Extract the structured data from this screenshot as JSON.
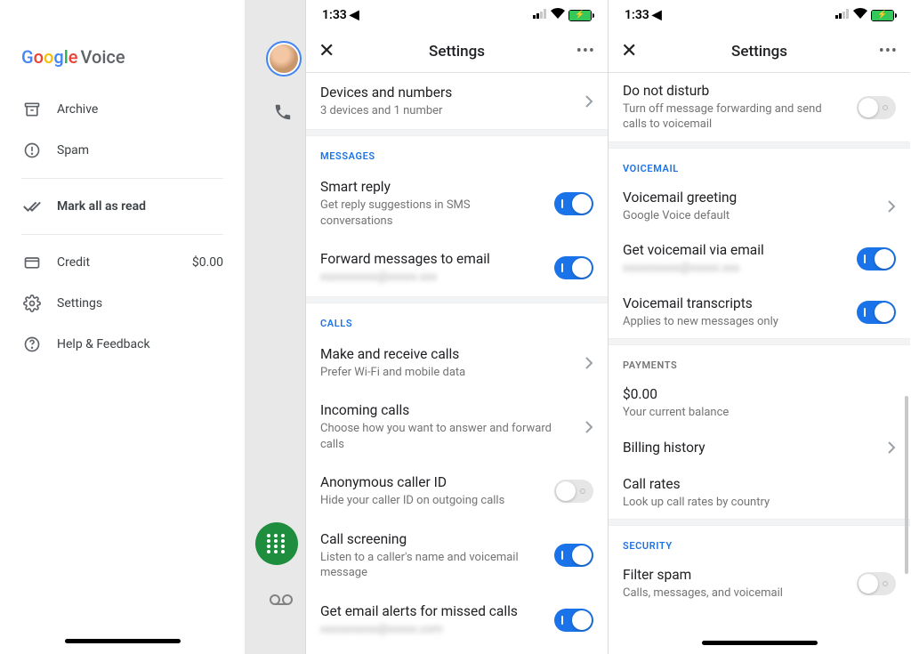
{
  "panel1": {
    "logo_voice": "Voice",
    "menu": {
      "archive": "Archive",
      "spam": "Spam",
      "mark_all": "Mark all as read",
      "credit": "Credit",
      "credit_value": "$0.00",
      "settings": "Settings",
      "help": "Help & Feedback"
    }
  },
  "status": {
    "time": "1:33"
  },
  "nav": {
    "title": "Settings"
  },
  "p2": {
    "devices_title": "Devices and numbers",
    "devices_sub": "3 devices and 1 number",
    "hdr_messages": "MESSAGES",
    "smart_title": "Smart reply",
    "smart_sub": "Get reply suggestions in SMS conversations",
    "fwd_title": "Forward messages to email",
    "fwd_sub": "xxxxxxxxxx@xxxxx.xxx",
    "hdr_calls": "CALLS",
    "make_title": "Make and receive calls",
    "make_sub": "Prefer Wi-Fi and mobile data",
    "incoming_title": "Incoming calls",
    "incoming_sub": "Choose how you want to answer and forward calls",
    "anon_title": "Anonymous caller ID",
    "anon_sub": "Hide your caller ID on outgoing calls",
    "screen_title": "Call screening",
    "screen_sub": "Listen to a caller's name and voicemail message",
    "missed_title": "Get email alerts for missed calls",
    "missed_sub": "xxxxxxxxxx@xxxxx.com"
  },
  "p3": {
    "dnd_title": "Do not disturb",
    "dnd_sub": "Turn off message forwarding and send calls to voicemail",
    "hdr_voicemail": "VOICEMAIL",
    "greet_title": "Voicemail greeting",
    "greet_sub": "Google Voice default",
    "vmemail_title": "Get voicemail via email",
    "vmemail_sub": "xxxxxxxxxx@xxxxx.xxx",
    "trans_title": "Voicemail transcripts",
    "trans_sub": "Applies to new messages only",
    "hdr_payments": "PAYMENTS",
    "balance_title": "$0.00",
    "balance_sub": "Your current balance",
    "billing_title": "Billing history",
    "rates_title": "Call rates",
    "rates_sub": "Look up call rates by country",
    "hdr_security": "SECURITY",
    "spam_title": "Filter spam",
    "spam_sub": "Calls, messages, and voicemail"
  }
}
